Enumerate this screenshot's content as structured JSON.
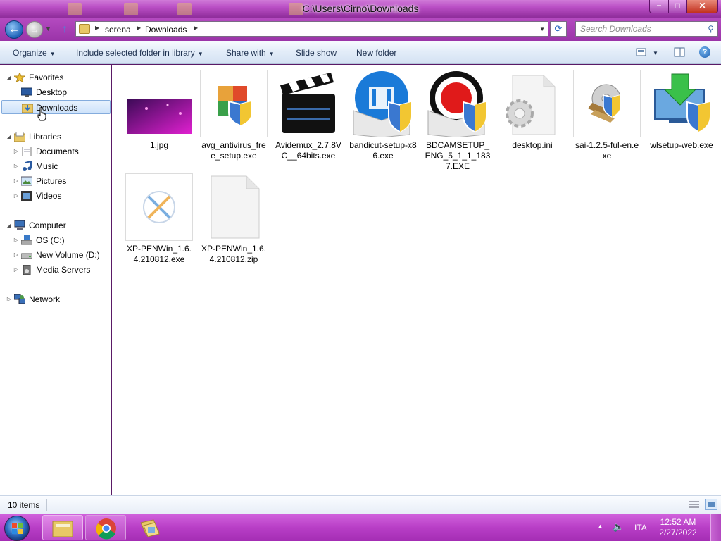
{
  "window": {
    "title": "C:\\Users\\Cirno\\Downloads",
    "controls": {
      "minimize": "−",
      "maximize": "□",
      "close": "✕"
    }
  },
  "nav": {
    "breadcrumb": [
      "serena",
      "Downloads"
    ],
    "search_placeholder": "Search Downloads"
  },
  "commands": {
    "organize": "Organize",
    "include": "Include selected folder in library",
    "share": "Share with",
    "slideshow": "Slide show",
    "newfolder": "New folder",
    "help": "?"
  },
  "sidebar": {
    "favorites": "Favorites",
    "desktop": "Desktop",
    "downloads": "Downloads",
    "libraries": "Libraries",
    "documents": "Documents",
    "music": "Music",
    "pictures": "Pictures",
    "videos": "Videos",
    "computer": "Computer",
    "osc": "OS (C:)",
    "newvol": "New Volume (D:)",
    "media": "Media Servers",
    "network": "Network"
  },
  "files": [
    {
      "name": "1.jpg",
      "icon": "image-thumbnail-icon"
    },
    {
      "name": "avg_antivirus_free_setup.exe",
      "icon": "avg-installer-icon"
    },
    {
      "name": "Avidemux_2.7.8VC__64bits.exe",
      "icon": "clapperboard-icon"
    },
    {
      "name": "bandicut-setup-x86.exe",
      "icon": "bandicut-installer-icon"
    },
    {
      "name": "BDCAMSETUP_ENG_5_1_1_1837.EXE",
      "icon": "bandicam-installer-icon"
    },
    {
      "name": "desktop.ini",
      "icon": "settings-file-icon"
    },
    {
      "name": "sai-1.2.5-ful-en.exe",
      "icon": "sai-installer-icon"
    },
    {
      "name": "wlsetup-web.exe",
      "icon": "windows-live-installer-icon"
    },
    {
      "name": "XP-PENWin_1.6.4.210812.exe",
      "icon": "xppen-app-icon"
    },
    {
      "name": "XP-PENWin_1.6.4.210812.zip",
      "icon": "blank-file-icon"
    }
  ],
  "status": {
    "count": "10 items"
  },
  "taskbar": {
    "lang": "ITA",
    "time": "12:52 AM",
    "date": "2/27/2022"
  },
  "colors": {
    "window_frame": "#b94ec4",
    "taskbar": "#b83ec6",
    "selection": "#cde2fa"
  }
}
